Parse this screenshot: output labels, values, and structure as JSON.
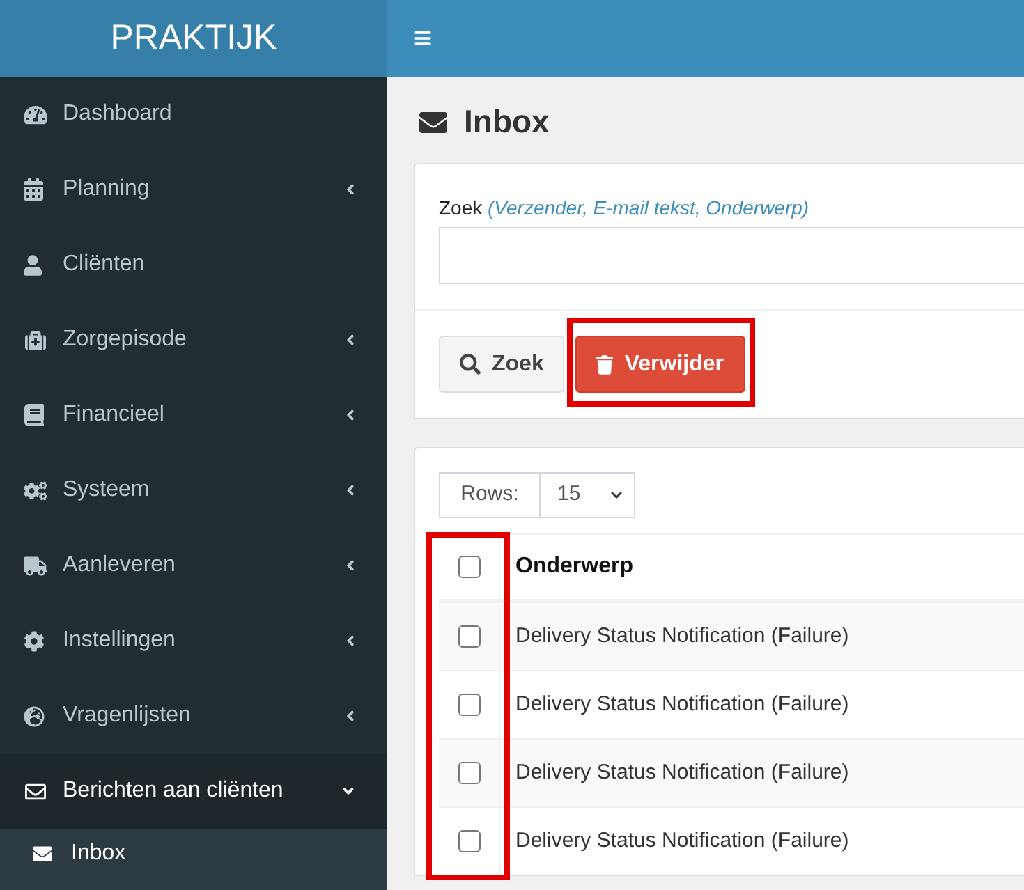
{
  "sidebar": {
    "brand": "PRAKTIJK",
    "items": [
      {
        "label": "Dashboard",
        "selected": false
      },
      {
        "label": "Planning",
        "selected": false,
        "expanded": false
      },
      {
        "label": "Cliënten",
        "selected": false
      },
      {
        "label": "Zorgepisode",
        "selected": false,
        "expanded": false
      },
      {
        "label": "Financieel",
        "selected": false,
        "expanded": false
      },
      {
        "label": "Systeem",
        "selected": false,
        "expanded": false
      },
      {
        "label": "Aanleveren",
        "selected": false,
        "expanded": false
      },
      {
        "label": "Instellingen",
        "selected": false,
        "expanded": false
      },
      {
        "label": "Vragenlijsten",
        "selected": false,
        "expanded": false
      },
      {
        "label": "Berichten aan cliënten",
        "selected": true,
        "expanded": true,
        "children": [
          {
            "label": "Inbox",
            "selected": true
          }
        ]
      }
    ]
  },
  "page": {
    "title": "Inbox"
  },
  "search": {
    "label": "Zoek *(Verzender, E-mail tekst, Onderwerp)*",
    "buttons": [
      {
        "label": "Zoek",
        "kind": "search",
        "highlighted": false
      },
      {
        "label": "Verwijder",
        "kind": "delete",
        "highlighted": true
      }
    ]
  },
  "table": {
    "rows_label": "Rows:",
    "rows_value": "15",
    "checkbox_column_highlighted": true,
    "select_all_checked": false,
    "columns": [
      "Onderwerp"
    ],
    "rows": [
      {
        "subject": "Delivery Status Notification (Failure)",
        "checked": false
      },
      {
        "subject": "Delivery Status Notification (Failure)",
        "checked": false
      },
      {
        "subject": "Delivery Status Notification (Failure)",
        "checked": false
      },
      {
        "subject": "Delivery Status Notification (Failure)",
        "checked": false
      }
    ]
  }
}
